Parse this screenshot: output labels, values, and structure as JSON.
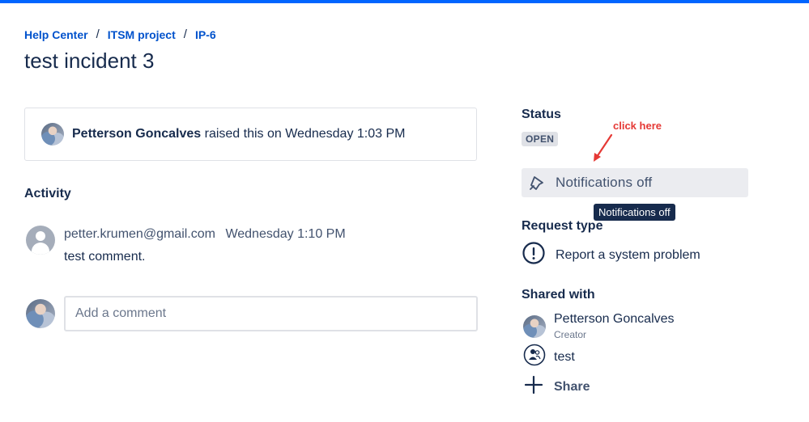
{
  "breadcrumb": {
    "items": [
      "Help Center",
      "ITSM project",
      "IP-6"
    ],
    "separator": "/"
  },
  "page": {
    "title": "test incident 3"
  },
  "raised": {
    "name": "Petterson Goncalves",
    "text": "raised this on Wednesday 1:03 PM"
  },
  "activity": {
    "heading": "Activity",
    "comments": [
      {
        "author": "petter.krumen@gmail.com",
        "time": "Wednesday 1:10 PM",
        "text": "test comment."
      }
    ],
    "add_comment_placeholder": "Add a comment"
  },
  "sidebar": {
    "status_heading": "Status",
    "status_value": "OPEN",
    "notifications_label": "Notifications off",
    "tooltip": "Notifications off",
    "annotation": "click here",
    "request_type_heading": "Request type",
    "request_type_value": "Report a system problem",
    "shared_with_heading": "Shared with",
    "shared": [
      {
        "name": "Petterson Goncalves",
        "role": "Creator",
        "icon": "user-avatar"
      },
      {
        "name": "test",
        "icon": "group-icon"
      }
    ],
    "share_label": "Share"
  },
  "colors": {
    "accent": "#0065ff",
    "link": "#0052cc",
    "annotation": "#e53935",
    "tooltip_bg": "#172b4d"
  }
}
